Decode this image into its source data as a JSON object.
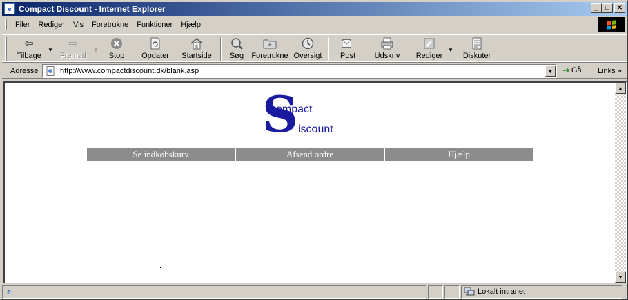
{
  "window": {
    "title": "Compact Discount - Internet Explorer",
    "minimize": "_",
    "maximize": "□",
    "close": "✕"
  },
  "menu": {
    "items": [
      {
        "label": "Filer",
        "accel": "F",
        "rest": "iler"
      },
      {
        "label": "Rediger",
        "accel": "R",
        "rest": "ediger"
      },
      {
        "label": "Vis",
        "accel": "V",
        "rest": "is"
      },
      {
        "label": "Foretrukne",
        "accel": "",
        "rest": "Foretrukne"
      },
      {
        "label": "Funktioner",
        "accel": "",
        "rest": "Funktioner"
      },
      {
        "label": "Hjælp",
        "accel": "H",
        "rest": "jælp"
      }
    ]
  },
  "toolbar": {
    "back": "Tilbage",
    "forward": "Fremad",
    "stop": "Stop",
    "refresh": "Opdater",
    "home": "Startside",
    "search": "Søg",
    "favorites": "Foretrukne",
    "history": "Oversigt",
    "mail": "Post",
    "print": "Udskriv",
    "edit": "Rediger",
    "discuss": "Diskuter",
    "icons": {
      "back": "arrow-left-icon",
      "forward": "arrow-right-icon",
      "stop": "stop-icon",
      "refresh": "refresh-icon",
      "home": "home-icon",
      "search": "search-icon",
      "favorites": "favorites-folder-icon",
      "history": "history-icon",
      "mail": "mail-icon",
      "print": "printer-icon",
      "edit": "edit-icon",
      "discuss": "discuss-icon"
    }
  },
  "address": {
    "label": "Adresse",
    "url": "http://www.compactdiscount.dk/blank.asp",
    "go": "Gå",
    "links": "Links »"
  },
  "page": {
    "logo_initial": "S",
    "logo_word1": "ompact",
    "logo_word2": "iscount",
    "nav": [
      "Se indkøbskurv",
      "Afsend ordre",
      "Hjælp"
    ]
  },
  "status": {
    "text": "",
    "zone": "Lokalt intranet"
  }
}
